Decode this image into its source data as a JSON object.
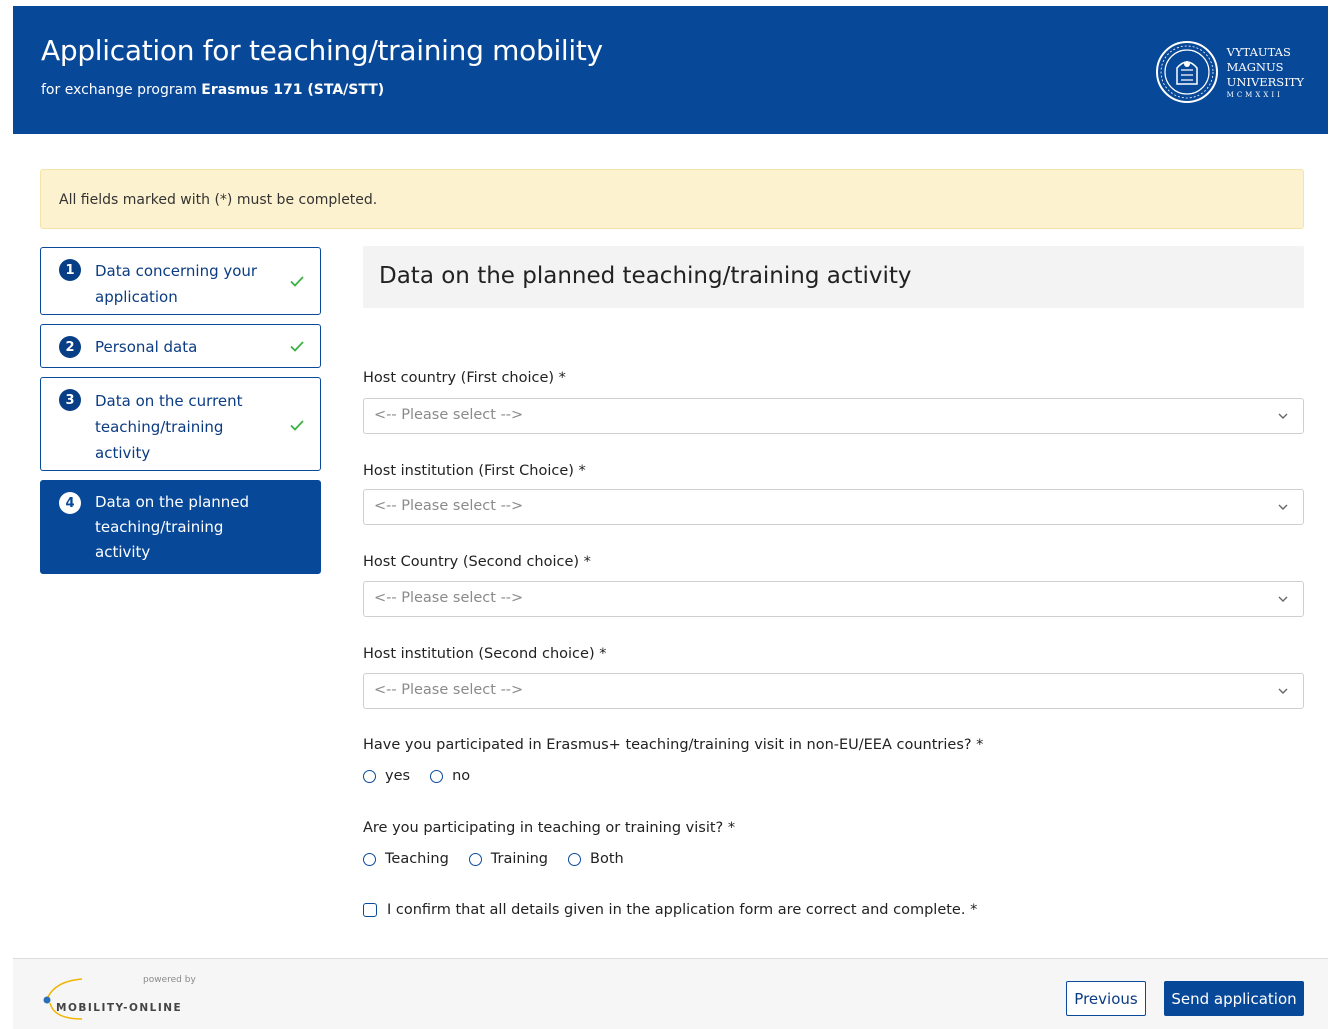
{
  "header": {
    "title": "Application for teaching/training mobility",
    "subtitle_prefix": "for exchange program ",
    "subtitle_program": "Erasmus 171 (STA/STT)",
    "university_line1": "VYTAUTAS",
    "university_line2": "MAGNUS",
    "university_line3": "UNIVERSITY",
    "university_line4": "MCMXXII"
  },
  "notice": "All fields marked with (*) must be completed.",
  "steps": [
    {
      "number": "1",
      "label": "Data concerning your application",
      "completed": true
    },
    {
      "number": "2",
      "label": "Personal data",
      "completed": true
    },
    {
      "number": "3",
      "label": "Data on the current teaching/training activity",
      "completed": true
    },
    {
      "number": "4",
      "label": "Data on the planned teaching/training activity",
      "completed": false,
      "active": true
    }
  ],
  "section_title": "Data on the planned teaching/training activity",
  "fields": {
    "host_country_first": {
      "label": "Host country (First choice) *",
      "placeholder": "<-- Please select -->"
    },
    "host_institution_first": {
      "label": "Host institution (First Choice) *",
      "placeholder": "<-- Please select -->"
    },
    "host_country_second": {
      "label": "Host Country (Second choice) *",
      "placeholder": "<-- Please select -->"
    },
    "host_institution_second": {
      "label": "Host institution (Second choice) *",
      "placeholder": "<-- Please select -->"
    }
  },
  "question_non_eu": {
    "label": "Have you participated in Erasmus+ teaching/training visit in non-EU/EEA countries? *",
    "options": [
      "yes",
      "no"
    ]
  },
  "question_visit_type": {
    "label": "Are you participating in teaching or training visit? *",
    "options": [
      "Teaching",
      "Training",
      "Both"
    ]
  },
  "confirm_label": "I confirm that all details given in the application form are correct and complete. *",
  "footer": {
    "powered_by": "powered by",
    "brand": "MOBILITY-ONLINE",
    "previous_label": "Previous",
    "send_label": "Send application"
  },
  "colors": {
    "primary": "#084898",
    "notice_bg": "#fdf2cf",
    "check_green": "#3cb043"
  }
}
